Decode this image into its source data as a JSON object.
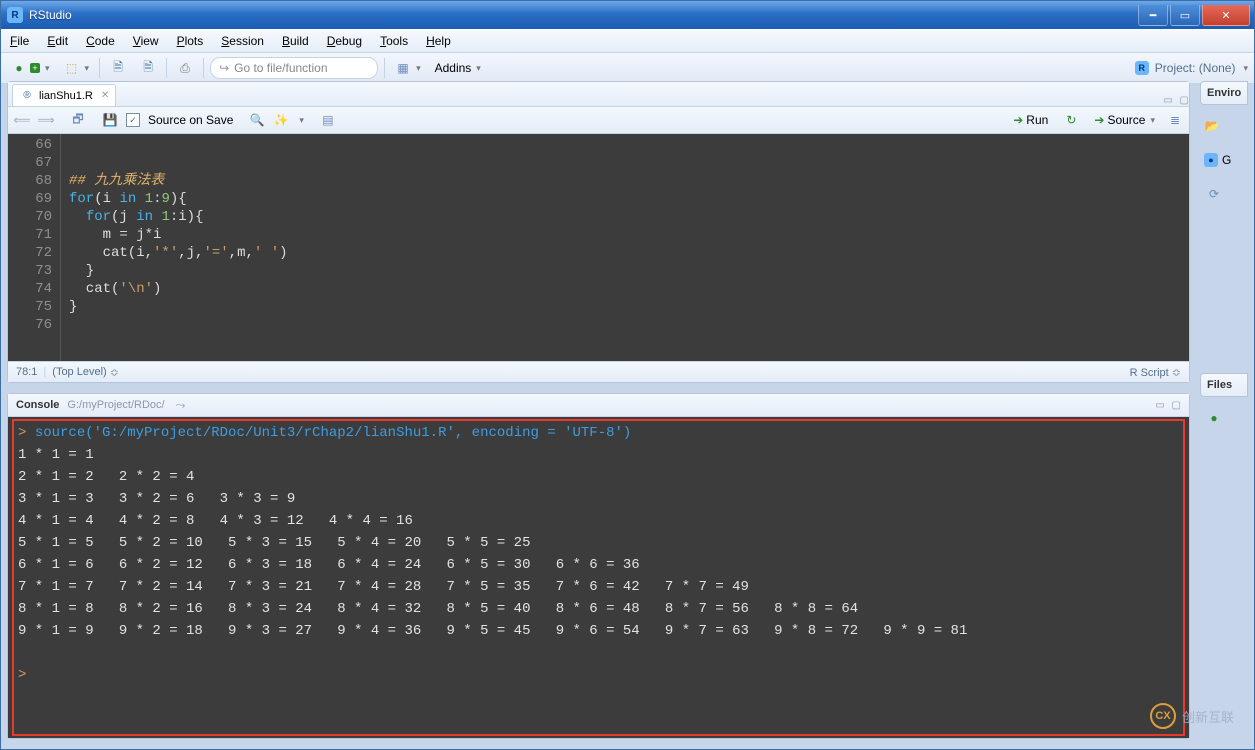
{
  "window": {
    "title": "RStudio"
  },
  "menu": [
    "File",
    "Edit",
    "Code",
    "View",
    "Plots",
    "Session",
    "Build",
    "Debug",
    "Tools",
    "Help"
  ],
  "toolbar": {
    "goto_placeholder": "Go to file/function",
    "addins_label": "Addins",
    "project_label": "Project: (None)"
  },
  "source": {
    "tab_name": "lianShu1.R",
    "source_on_save_label": "Source on Save",
    "run_label": "Run",
    "source_label": "Source",
    "status_pos": "78:1",
    "status_scope": "(Top Level)",
    "status_lang": "R Script",
    "lines": [
      {
        "n": 66,
        "raw": ""
      },
      {
        "n": 67,
        "raw": ""
      },
      {
        "n": 68,
        "raw": "## 九九乘法表",
        "cls": "com"
      },
      {
        "n": 69,
        "raw": "for(i in 1:9){",
        "html": "<span class=\"kw\">for</span>(i <span class=\"kw\">in</span> <span class=\"num\">1</span><span class=\"op\">:</span><span class=\"num\">9</span>){"
      },
      {
        "n": 70,
        "raw": "  for(j in 1:i){",
        "html": "  <span class=\"kw\">for</span>(j <span class=\"kw\">in</span> <span class=\"num\">1</span><span class=\"op\">:</span>i){"
      },
      {
        "n": 71,
        "raw": "    m = j*i",
        "html": "    m <span class=\"op\">=</span> j<span class=\"op\">*</span>i"
      },
      {
        "n": 72,
        "raw": "    cat(i,'*',j,'=',m,' ')",
        "html": "    cat(i,<span class=\"str\">'*'</span>,j,<span class=\"str\">'='</span>,m,<span class=\"str\">' '</span>)"
      },
      {
        "n": 73,
        "raw": "  }",
        "html": "  }"
      },
      {
        "n": 74,
        "raw": "  cat('\\n')",
        "html": "  cat(<span class=\"str\">'\\n'</span>)"
      },
      {
        "n": 75,
        "raw": "}",
        "html": "}"
      },
      {
        "n": 76,
        "raw": ""
      }
    ]
  },
  "console": {
    "title": "Console",
    "path": "G:/myProject/RDoc/",
    "source_cmd": "source('G:/myProject/RDoc/Unit3/rChap2/lianShu1.R', encoding = 'UTF-8')",
    "output": [
      "1 * 1 = 1",
      "2 * 1 = 2   2 * 2 = 4",
      "3 * 1 = 3   3 * 2 = 6   3 * 3 = 9",
      "4 * 1 = 4   4 * 2 = 8   4 * 3 = 12   4 * 4 = 16",
      "5 * 1 = 5   5 * 2 = 10   5 * 3 = 15   5 * 4 = 20   5 * 5 = 25",
      "6 * 1 = 6   6 * 2 = 12   6 * 3 = 18   6 * 4 = 24   6 * 5 = 30   6 * 6 = 36",
      "7 * 1 = 7   7 * 2 = 14   7 * 3 = 21   7 * 4 = 28   7 * 5 = 35   7 * 6 = 42   7 * 7 = 49",
      "8 * 1 = 8   8 * 2 = 16   8 * 3 = 24   8 * 4 = 32   8 * 5 = 40   8 * 6 = 48   8 * 7 = 56   8 * 8 = 64",
      "9 * 1 = 9   9 * 2 = 18   9 * 3 = 27   9 * 4 = 36   9 * 5 = 45   9 * 6 = 54   9 * 7 = 63   9 * 8 = 72   9 * 9 = 81"
    ],
    "prompt": ">"
  },
  "right_panels": {
    "env_label": "Enviro",
    "files_label": "Files",
    "global_icon": "G"
  },
  "watermark": "创新互联"
}
